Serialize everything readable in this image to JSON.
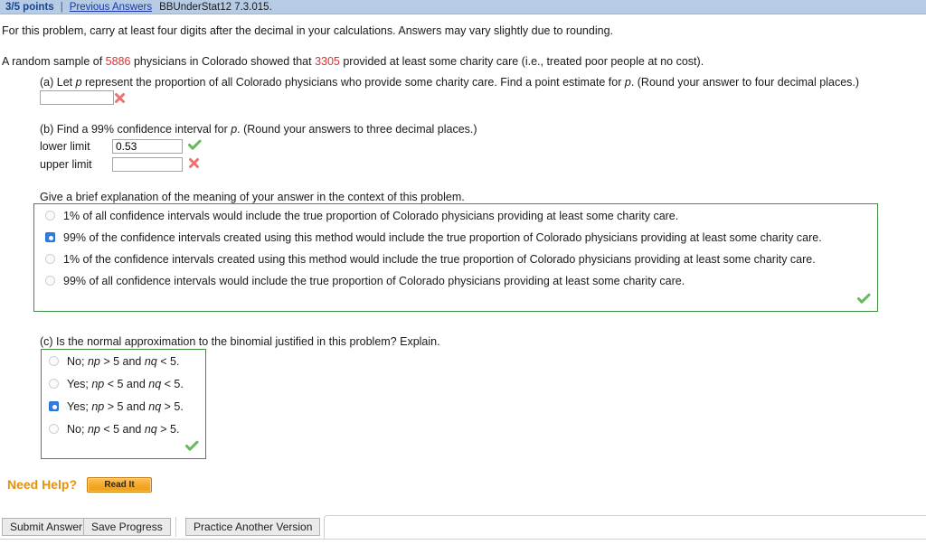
{
  "status_bar": {
    "points": "3/5 points",
    "separator": "|",
    "previous_answers": "Previous Answers",
    "question_id": "BBUnderStat12 7.3.015."
  },
  "intro": {
    "line1": "For this problem, carry at least four digits after the decimal in your calculations. Answers may vary slightly due to rounding.",
    "sample_pre": "A random sample of ",
    "sample_n": "5886",
    "sample_mid": " physicians in Colorado showed that ",
    "sample_x": "3305",
    "sample_post": " provided at least some charity care (i.e., treated poor people at no cost)."
  },
  "part_a": {
    "label": "(a) Let ",
    "var": "p",
    "text_mid": " represent the proportion of all Colorado physicians who provide some charity care. Find a point estimate for ",
    "var2": "p",
    "text_end": ". (Round your answer to four decimal places.)",
    "input_value": "",
    "input_placeholder": "",
    "mark": "incorrect"
  },
  "part_b": {
    "question_pre": "(b) Find a 99% confidence interval for ",
    "question_var": "p",
    "question_post": ". (Round your answers to three decimal places.)",
    "lower_label": "lower limit",
    "lower_value": "0.53",
    "lower_mark": "correct",
    "upper_label": "upper limit",
    "upper_value": "",
    "upper_mark": "incorrect"
  },
  "explanation": {
    "prompt": "Give a brief explanation of the meaning of your answer in the context of this problem.",
    "options": [
      {
        "label": "1% of all confidence intervals would include the true proportion of Colorado physicians providing at least some charity care.",
        "selected": false
      },
      {
        "label": "99% of the confidence intervals created using this method would include the true proportion of Colorado physicians providing at least some charity care.",
        "selected": true
      },
      {
        "label": "1% of the confidence intervals created using this method would include the true proportion of Colorado physicians providing at least some charity care.",
        "selected": false
      },
      {
        "label": "99% of all confidence intervals would include the true proportion of Colorado physicians providing at least some charity care.",
        "selected": false
      }
    ],
    "mark": "correct"
  },
  "part_c": {
    "question": "(c) Is the normal approximation to the binomial justified in this problem? Explain.",
    "options": [
      {
        "prefix": "No; ",
        "v1": "np",
        "op1": " > 5 and ",
        "v2": "nq",
        "op2": " < 5.",
        "selected": false
      },
      {
        "prefix": "Yes; ",
        "v1": "np",
        "op1": " < 5 and ",
        "v2": "nq",
        "op2": " < 5.",
        "selected": false
      },
      {
        "prefix": "Yes; ",
        "v1": "np",
        "op1": " > 5 and ",
        "v2": "nq",
        "op2": " > 5.",
        "selected": true
      },
      {
        "prefix": "No; ",
        "v1": "np",
        "op1": " < 5 and ",
        "v2": "nq",
        "op2": " > 5.",
        "selected": false
      }
    ],
    "mark": "correct"
  },
  "help": {
    "label": "Need Help?",
    "read_it_button": "Read It"
  },
  "footer": {
    "submit_answer": "Submit Answer",
    "save_progress": "Save Progress",
    "practice_another": "Practice Another Version"
  },
  "colors": {
    "status_bar_bg": "#b6cbe4",
    "points_text": "#17458f",
    "link": "#1a38a8",
    "red_number": "#e03030",
    "green_border": "#3f9141",
    "check_green": "#67b95c",
    "cross_red": "#f07070",
    "radio_blue": "#2f7ce0",
    "help_orange": "#e8900c"
  }
}
